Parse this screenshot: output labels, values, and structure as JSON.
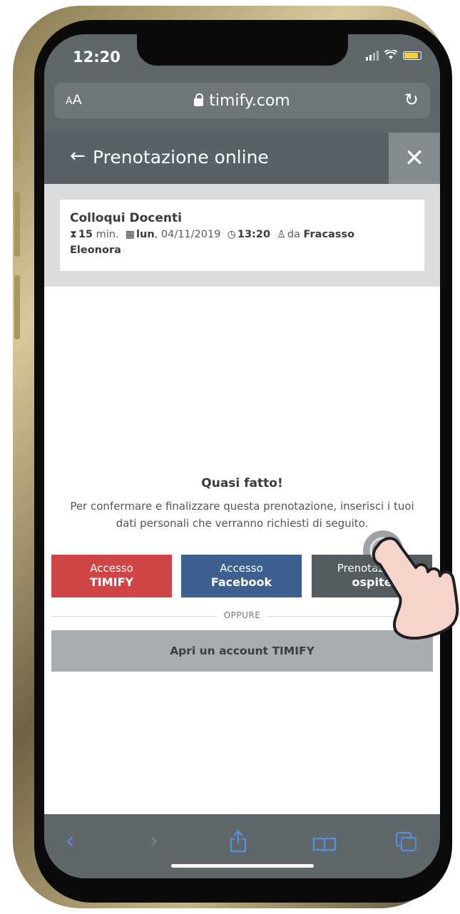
{
  "status": {
    "time": "12:20"
  },
  "browser": {
    "text_size": "AA",
    "domain": "timify.com"
  },
  "header": {
    "title": "Prenotazione online"
  },
  "booking": {
    "service": "Colloqui Docenti",
    "duration_value": "15",
    "duration_unit": "min.",
    "day": "lun",
    "date": ", 04/11/2019",
    "time": "13:20",
    "staff_prefix": "da",
    "staff_name": "Fracasso",
    "staff_name_2": "Eleonora"
  },
  "main": {
    "heading": "Quasi fatto!",
    "description": "Per confermare e finalizzare questa prenotazione, inserisci i tuoi dati personali che verranno richiesti di seguito.",
    "buttons": {
      "timify_line1": "Accesso",
      "timify_line2": "TIMIFY",
      "facebook_line1": "Accesso",
      "facebook_line2": "Facebook",
      "guest_line1": "Prenotazione",
      "guest_line2": "ospite"
    },
    "separator": "OPPURE",
    "create_account": "Apri un account TIMIFY"
  },
  "colors": {
    "timify_red": "#cf4546",
    "facebook_blue": "#3b5f8e",
    "guest_gray": "#555c60",
    "toolbar_blue": "#5a8fe0"
  },
  "icons": {
    "duration": "hourglass-icon",
    "date": "calendar-icon",
    "time": "clock-icon",
    "staff": "user-icon"
  }
}
